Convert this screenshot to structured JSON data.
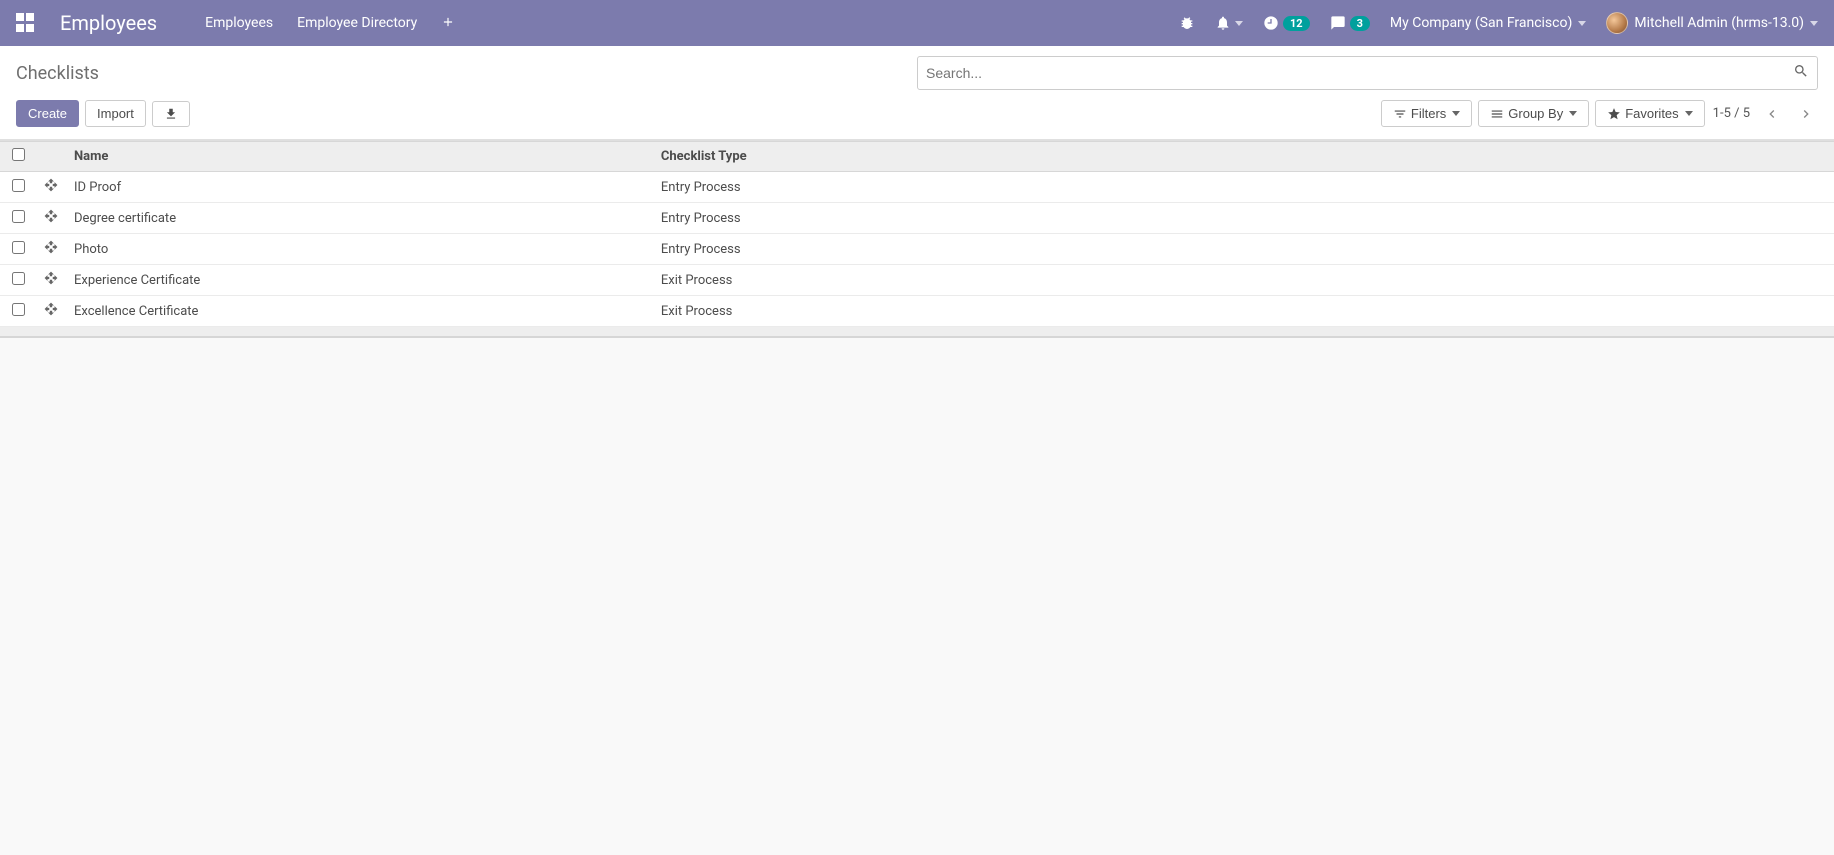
{
  "navbar": {
    "brand": "Employees",
    "links": [
      "Employees",
      "Employee Directory"
    ],
    "activity_count": "12",
    "discuss_count": "3",
    "company": "My Company (San Francisco)",
    "user": "Mitchell Admin (hrms-13.0)"
  },
  "control_panel": {
    "breadcrumb": "Checklists",
    "search_placeholder": "Search...",
    "create_label": "Create",
    "import_label": "Import",
    "filters_label": "Filters",
    "groupby_label": "Group By",
    "favorites_label": "Favorites",
    "pager_text": "1-5 / 5"
  },
  "table": {
    "headers": {
      "name": "Name",
      "checklist_type": "Checklist Type"
    },
    "rows": [
      {
        "name": "ID Proof",
        "type": "Entry Process"
      },
      {
        "name": "Degree certificate",
        "type": "Entry Process"
      },
      {
        "name": "Photo",
        "type": "Entry Process"
      },
      {
        "name": "Experience Certificate",
        "type": "Exit Process"
      },
      {
        "name": "Excellence Certificate",
        "type": "Exit Process"
      }
    ]
  }
}
